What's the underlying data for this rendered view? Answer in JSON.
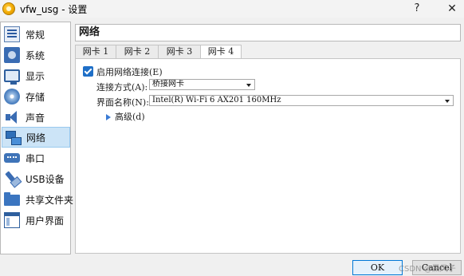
{
  "window": {
    "title": "vfw_usg - 设置",
    "help_symbol": "?",
    "close_symbol": "✕",
    "app_icon": "virtualbox-icon"
  },
  "sidebar": {
    "items": [
      {
        "label": "常规",
        "icon": "general-icon"
      },
      {
        "label": "系统",
        "icon": "system-chip-icon"
      },
      {
        "label": "显示",
        "icon": "display-monitor-icon"
      },
      {
        "label": "存储",
        "icon": "storage-disk-icon"
      },
      {
        "label": "声音",
        "icon": "speaker-icon"
      },
      {
        "label": "网络",
        "icon": "network-icon",
        "selected": true
      },
      {
        "label": "串口",
        "icon": "serial-port-icon"
      },
      {
        "label": "USB设备",
        "icon": "usb-icon"
      },
      {
        "label": "共享文件夹",
        "icon": "shared-folder-icon"
      },
      {
        "label": "用户界面",
        "icon": "user-interface-icon"
      }
    ]
  },
  "main": {
    "title": "网络",
    "tabs": [
      {
        "label": "网卡 1"
      },
      {
        "label": "网卡 2"
      },
      {
        "label": "网卡 3"
      },
      {
        "label": "网卡 4",
        "active": true
      }
    ],
    "enable_checkbox": {
      "label": "启用网络连接(E)",
      "checked": true
    },
    "attached_to": {
      "label": "连接方式(A):",
      "value": "桥接网卡"
    },
    "interface_name": {
      "label": "界面名称(N):",
      "value": "Intel(R) Wi-Fi 6 AX201 160MHz"
    },
    "advanced": {
      "label": "高级(d)",
      "expanded": false
    }
  },
  "buttons": {
    "ok": "OK",
    "cancel": "Cancel"
  },
  "watermark": "CSDN @黑风子",
  "colors": {
    "accent": "#1e6fc7",
    "selection": "#cce4f7"
  }
}
